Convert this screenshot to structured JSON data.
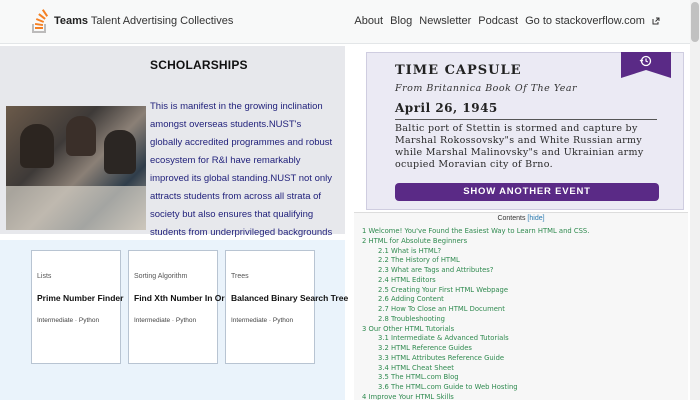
{
  "topbar": {
    "brand_bold": "Teams",
    "brand_rest": "Talent Advertising Collectives",
    "nav": [
      "About",
      "Blog",
      "Newsletter",
      "Podcast",
      "Go to stackoverflow.com"
    ],
    "logo_icon": "stack-overflow-logo-icon",
    "external_icon": "external-link-icon"
  },
  "scholarships": {
    "title": "SCHOLARSHIPS",
    "body": "This is manifest in the growing inclination amongst overseas students.NUST's globally accredited programmes and robust ecosystem for R&I have remarkably improved its global standing.NUST not only attracts students from across all strata of society but also ensures that qualifying students from underprivileged backgrounds are not turned away due to lack of financial resources."
  },
  "time_capsule": {
    "title": "TIME CAPSULE",
    "subtitle": "From Britannica Book Of The Year",
    "date": "April 26, 1945",
    "body": "Baltic port of Stettin is stormed and capture by Marshal Rokossovsky\"s and White Russian army while Marshal Malinovsky\"s and Ukrainian army ocupied Moravian city of Brno.",
    "button": "SHOW ANOTHER EVENT",
    "ribbon_icon": "clock-history-icon",
    "accent": "#5a2a86"
  },
  "cards": [
    {
      "category": "Lists",
      "title": "Prime Number Finder",
      "meta": "Intermediate · Python"
    },
    {
      "category": "Sorting Algorithm",
      "title": "Find Xth Number In Order",
      "meta": "Intermediate · Python"
    },
    {
      "category": "Trees",
      "title": "Balanced Binary Search Tree",
      "meta": "Intermediate · Python"
    }
  ],
  "contents": {
    "title": "Contents",
    "hide": "[hide]",
    "items": [
      {
        "text": "1 Welcome! You've Found the Easiest Way to Learn HTML and CSS.",
        "level": 1
      },
      {
        "text": "2 HTML for Absolute Beginners",
        "level": 1
      },
      {
        "text": "2.1 What is HTML?",
        "level": 2
      },
      {
        "text": "2.2 The History of HTML",
        "level": 2
      },
      {
        "text": "2.3 What are Tags and Attributes?",
        "level": 2
      },
      {
        "text": "2.4 HTML Editors",
        "level": 2
      },
      {
        "text": "2.5 Creating Your First HTML Webpage",
        "level": 2
      },
      {
        "text": "2.6 Adding Content",
        "level": 2
      },
      {
        "text": "2.7 How To Close an HTML Document",
        "level": 2
      },
      {
        "text": "2.8 Troubleshooting",
        "level": 2
      },
      {
        "text": "3 Our Other HTML Tutorials",
        "level": 1
      },
      {
        "text": "3.1 Intermediate & Advanced Tutorials",
        "level": 2
      },
      {
        "text": "3.2 HTML Reference Guides",
        "level": 2
      },
      {
        "text": "3.3 HTML Attributes Reference Guide",
        "level": 2
      },
      {
        "text": "3.4 HTML Cheat Sheet",
        "level": 2
      },
      {
        "text": "3.5 The HTML.com Blog",
        "level": 2
      },
      {
        "text": "3.6 The HTML.com Guide to Web Hosting",
        "level": 2
      },
      {
        "text": "4 Improve Your HTML Skills",
        "level": 1
      }
    ],
    "link_color": "#2f8a4f"
  }
}
